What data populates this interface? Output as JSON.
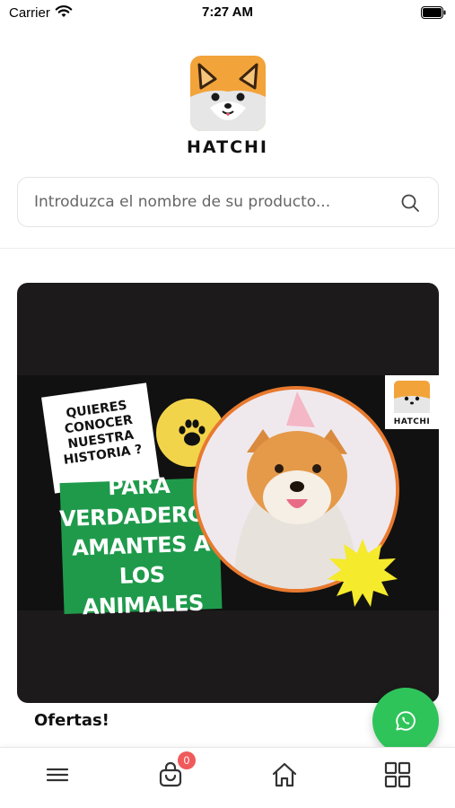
{
  "status_bar": {
    "carrier": "Carrier",
    "time": "7:27 AM"
  },
  "brand": {
    "name": "HATCHI",
    "accent_color": "#f2a33a"
  },
  "search": {
    "placeholder": "Introduzca el nombre de su producto..."
  },
  "banner": {
    "question": "QUIERES\nCONOCER\nNUESTRA\nHISTORIA ?",
    "headline": "PARA\nVERDADEROS\nAMANTES A\nLOS ANIMALES",
    "badge_icon": "paw-icon",
    "mini_logo_text": "HATCHI"
  },
  "section": {
    "title": "Ofertas!"
  },
  "fab": {
    "icon": "whatsapp-icon",
    "color": "#2fc45a"
  },
  "bottom_nav": {
    "items": [
      {
        "icon": "menu-icon"
      },
      {
        "icon": "shopping-bag-icon",
        "badge": "0"
      },
      {
        "icon": "home-icon"
      },
      {
        "icon": "grid-icon"
      }
    ]
  }
}
